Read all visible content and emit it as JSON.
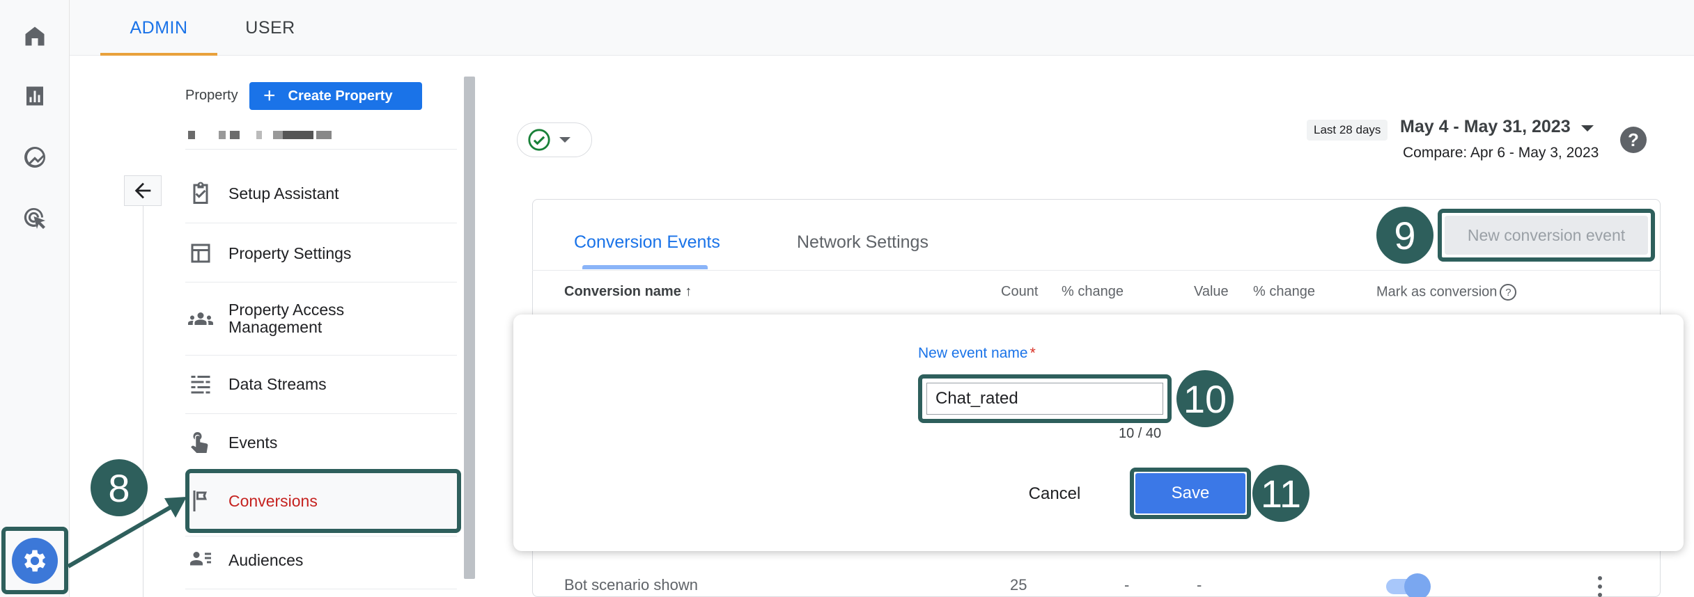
{
  "top_tabs": {
    "admin": "ADMIN",
    "user": "USER"
  },
  "property": {
    "label": "Property",
    "create_button": "Create Property",
    "create_plus": "+"
  },
  "nav": [
    {
      "label": "Setup Assistant",
      "icon": "clipboard-check-icon"
    },
    {
      "label": "Property Settings",
      "icon": "layout-icon"
    },
    {
      "label": "Property Access Management",
      "icon": "people-icon"
    },
    {
      "label": "Data Streams",
      "icon": "streams-icon"
    },
    {
      "label": "Events",
      "icon": "touch-icon"
    },
    {
      "label": "Conversions",
      "icon": "flag-icon",
      "active": true
    },
    {
      "label": "Audiences",
      "icon": "audience-icon"
    }
  ],
  "date_range": {
    "badge": "Last 28 days",
    "range": "May 4 - May 31, 2023",
    "compare": "Compare: Apr 6 - May 3, 2023"
  },
  "help_label": "?",
  "tabs": {
    "conversion_events": "Conversion Events",
    "network_settings": "Network Settings"
  },
  "new_conversion_button": "New conversion event",
  "table": {
    "headers": {
      "name": "Conversion name ↑",
      "count": "Count",
      "change1": "% change",
      "value": "Value",
      "change2": "% change",
      "mark": "Mark as conversion"
    },
    "row": {
      "name": "Bot scenario shown",
      "count": "25",
      "change": "-",
      "value": "-",
      "marked": true
    }
  },
  "dialog": {
    "label": "New event name",
    "required_mark": "*",
    "value": "Chat_rated",
    "counter": "10 / 40",
    "cancel": "Cancel",
    "save": "Save"
  },
  "steps": {
    "s8": "8",
    "s9": "9",
    "s10": "10",
    "s11": "11"
  },
  "colors": {
    "annotation": "#2e5f5c",
    "primary": "#1a73e8",
    "active_nav": "#c5221f"
  }
}
